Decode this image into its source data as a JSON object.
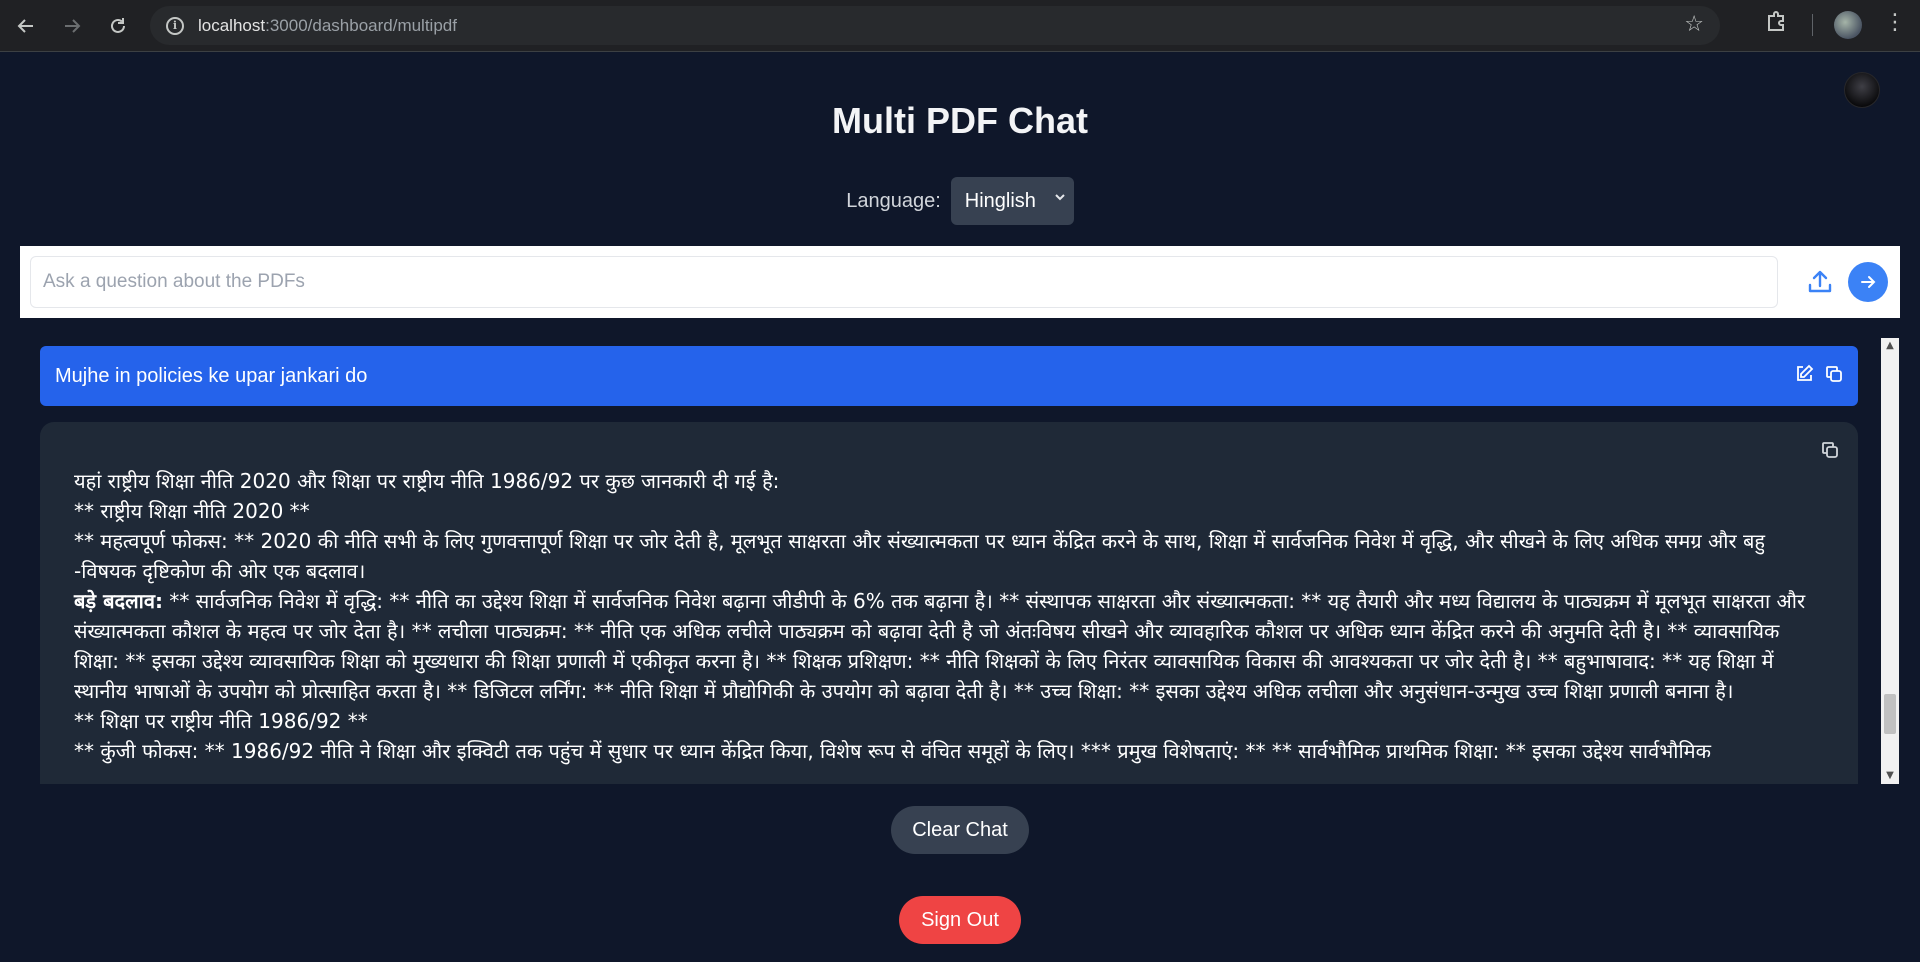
{
  "browser": {
    "url_host": "localhost",
    "url_path": ":3000/dashboard/multipdf"
  },
  "app": {
    "title": "Multi PDF Chat",
    "language_label": "Language:",
    "language_value": "Hinglish",
    "input_placeholder": "Ask a question about the PDFs"
  },
  "chat": {
    "user_message": "Mujhe in policies ke upar jankari do",
    "bot_lines": [
      "यहां राष्ट्रीय शिक्षा नीति 2020 और शिक्षा पर राष्ट्रीय नीति 1986/92 पर कुछ जानकारी दी गई है:",
      "** राष्ट्रीय शिक्षा नीति 2020 **",
      "** महत्वपूर्ण फोकस: ** 2020 की नीति सभी के लिए गुणवत्तापूर्ण शिक्षा पर जोर देती है, मूलभूत साक्षरता और संख्यात्मकता पर ध्यान केंद्रित करने के साथ, शिक्षा में सार्वजनिक निवेश में वृद्धि, और सीखने के लिए अधिक समग्र और बहु -विषयक दृष्टिकोण की ओर एक बदलाव।"
    ],
    "bot_bold_prefix": "बड़े बदलाव:",
    "bot_para_changes": " ** सार्वजनिक निवेश में वृद्धि: ** नीति का उद्देश्य शिक्षा में सार्वजनिक निवेश बढ़ाना जीडीपी के 6% तक बढ़ाना है। ** संस्थापक साक्षरता और संख्यात्मकता: ** यह तैयारी और मध्य विद्यालय के पाठ्यक्रम में मूलभूत साक्षरता और संख्यात्मकता कौशल के महत्व पर जोर देता है। ** लचीला पाठ्यक्रम: ** नीति एक अधिक लचीले पाठ्यक्रम को बढ़ावा देती है जो अंतःविषय सीखने और व्यावहारिक कौशल पर अधिक ध्यान केंद्रित करने की अनुमति देती है। ** व्यावसायिक शिक्षा: ** इसका उद्देश्य व्यावसायिक शिक्षा को मुख्यधारा की शिक्षा प्रणाली में एकीकृत करना है। ** शिक्षक प्रशिक्षण: ** नीति शिक्षकों के लिए निरंतर व्यावसायिक विकास की आवश्यकता पर जोर देती है। ** बहुभाषावाद: ** यह शिक्षा में स्थानीय भाषाओं के उपयोग को प्रोत्साहित करता है। ** डिजिटल लर्निंग: ** नीति शिक्षा में प्रौद्योगिकी के उपयोग को बढ़ावा देती है। ** उच्च शिक्षा: ** इसका उद्देश्य अधिक लचीला और अनुसंधान-उन्मुख उच्च शिक्षा प्रणाली बनाना है।",
    "bot_line_1986": "** शिक्षा पर राष्ट्रीय नीति 1986/92 **",
    "bot_line_key": "** कुंजी फोकस: ** 1986/92 नीति ने शिक्षा और इक्विटी तक पहुंच में सुधार पर ध्यान केंद्रित किया, विशेष रूप से वंचित समूहों के लिए। *** प्रमुख विशेषताएं: ** ** सार्वभौमिक प्राथमिक शिक्षा: ** इसका उद्देश्य सार्वभौमिक"
  },
  "actions": {
    "clear_chat": "Clear Chat",
    "sign_out": "Sign Out"
  },
  "colors": {
    "background": "#0f172a",
    "user_bubble": "#2563eb",
    "bot_bubble": "#1f2937",
    "send_button": "#3b82f6",
    "sign_out": "#ef4444"
  },
  "icons": {
    "back": "back-arrow-icon",
    "forward": "forward-arrow-icon",
    "reload": "reload-icon",
    "info": "site-info-icon",
    "bookmark": "star-icon",
    "extensions": "puzzle-icon",
    "menu": "kebab-menu-icon",
    "upload": "upload-icon",
    "send": "arrow-right-icon",
    "edit": "edit-icon",
    "copy": "copy-icon"
  }
}
